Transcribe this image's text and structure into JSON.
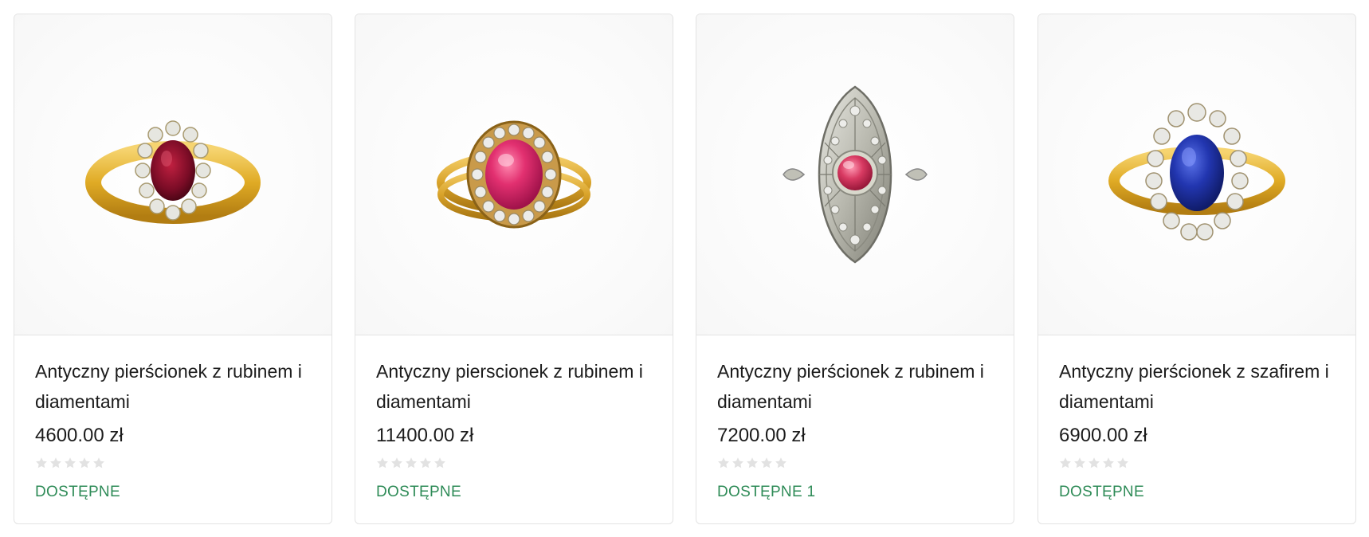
{
  "products": [
    {
      "title": "Antyczny pierścionek z rubinem i diamentami",
      "price": "4600.00 zł",
      "stock": "DOSTĘPNE",
      "rating": 0,
      "stone": "ruby-oval",
      "stone_color": "#8d1030",
      "metal_color": "#e0b12b"
    },
    {
      "title": "Antyczny pierscionek z rubinem i diamentami",
      "price": "11400.00 zł",
      "stock": "DOSTĘPNE",
      "rating": 0,
      "stone": "ruby-cabochon-halo",
      "stone_color": "#e0306e",
      "metal_color": "#d9a92c"
    },
    {
      "title": "Antyczny pierścionek z rubinem i diamentami",
      "price": "7200.00 zł",
      "stock": "DOSTĘPNE 1",
      "rating": 0,
      "stone": "ruby-navette",
      "stone_color": "#d83a62",
      "metal_color": "#b8b8b0"
    },
    {
      "title": "Antyczny pierścionek z szafirem i diamentami",
      "price": "6900.00 zł",
      "stock": "DOSTĘPNE",
      "rating": 0,
      "stone": "sapphire-oval",
      "stone_color": "#2030a8",
      "metal_color": "#e0b12b"
    }
  ],
  "colors": {
    "stock_green": "#2e8b57",
    "star_empty": "#e2e2e2"
  }
}
